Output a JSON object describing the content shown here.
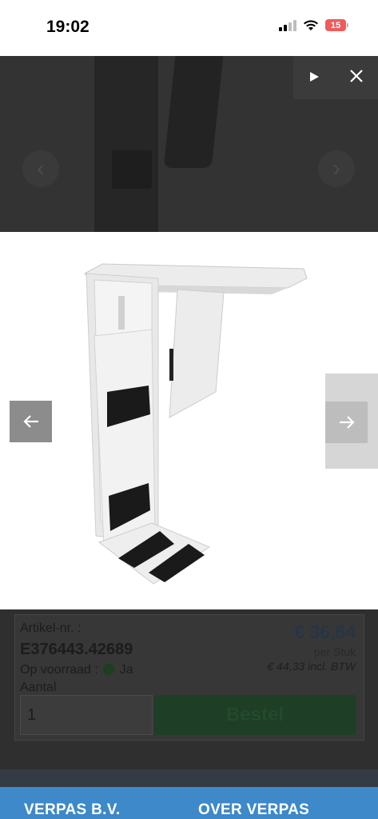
{
  "status_bar": {
    "time": "19:02",
    "battery": "15"
  },
  "lightbox": {
    "play_icon": "play-icon",
    "close_icon": "close-icon",
    "prev_icon": "arrow-left-icon",
    "next_icon": "arrow-right-icon"
  },
  "product": {
    "article_label": "Artikel-nr. :",
    "article_number": "E376443.42689",
    "stock_label": "Op voorraad :",
    "stock_value": "Ja",
    "quantity_label": "Aantal",
    "quantity_value": "1",
    "price": "€ 36,64",
    "per_unit": "per Stuk",
    "price_incl": "€ 44,33 incl. BTW",
    "order_button": "Bestel"
  },
  "footer": {
    "item1": "VERPAS B.V.",
    "item2": "OVER VERPAS"
  }
}
